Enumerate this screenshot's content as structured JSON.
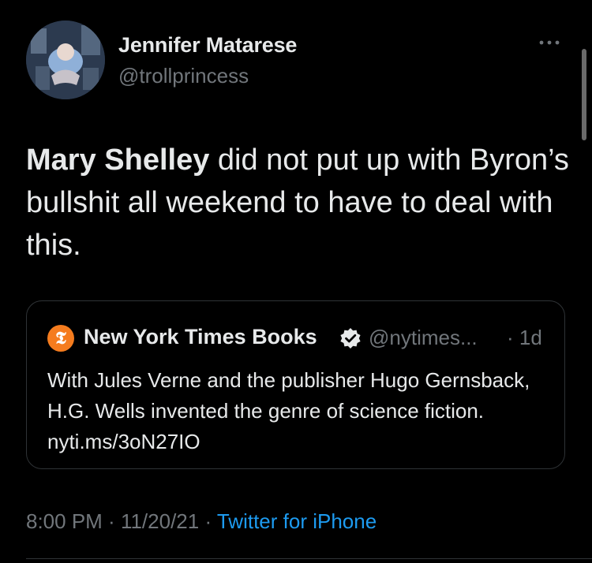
{
  "tweet": {
    "author": {
      "display_name": "Jennifer Matarese",
      "handle": "@trollprincess",
      "avatar": "profile-photo"
    },
    "more_icon": "more-dots-icon",
    "text_bold": "Mary Shelley",
    "text_rest": " did not put up with Byron’s bullshit all weekend to have to deal with this.",
    "quoted": {
      "logo_glyph": "𝕿",
      "name": "New York Times Books",
      "verified_icon": "verified-badge-icon",
      "handle": "@nytimes...",
      "time": "· 1d",
      "text": "With Jules Verne and the publisher Hugo Gernsback, H.G. Wells invented the genre of science fiction. nyti.ms/3oN27IO"
    },
    "meta": {
      "time": "8:00 PM",
      "sep1": " · ",
      "date": "11/20/21",
      "sep2": " · ",
      "source": "Twitter for iPhone"
    }
  },
  "colors": {
    "background": "#000000",
    "primary_text": "#e7e9ea",
    "secondary_text": "#71767b",
    "link": "#1d9bf0",
    "border": "#2f3336",
    "nyt_logo": "#f57c1e"
  }
}
